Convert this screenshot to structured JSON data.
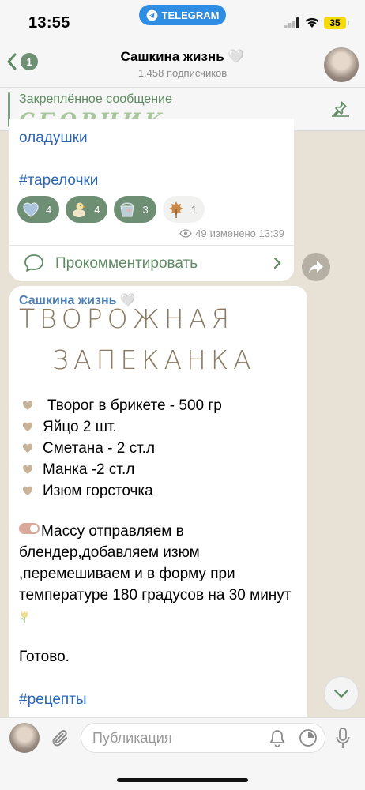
{
  "status_bar": {
    "time": "13:55",
    "app_pill": "TELEGRAM",
    "battery": "35"
  },
  "header": {
    "back_count": "1",
    "title": "Сашкина жизнь 🤍",
    "subtitle": "1.458 подписчиков"
  },
  "pinned": {
    "label": "Закреплённое сообщение",
    "text": "СБОРНИК"
  },
  "post1": {
    "partial_text": "оладушки",
    "hashtag": "#тарелочки",
    "reactions": [
      {
        "icon": "blue-heart-icon",
        "count": "4"
      },
      {
        "icon": "duck-icon",
        "count": "4"
      },
      {
        "icon": "bucket-icon",
        "count": "3"
      },
      {
        "icon": "autumn-leaf-icon",
        "count": "1"
      }
    ],
    "views": "49",
    "edited": "изменено 13:39",
    "comment_label": "Прокомментировать"
  },
  "post2": {
    "author": "Сашкина жизнь 🤍",
    "heading_line1": "ТВОРОЖНАЯ",
    "heading_line2": "ЗАПЕКАНКА",
    "ingredients": [
      "Творог в брикете - 500 гр",
      "Яйцо 2 шт.",
      "Сметана - 2 ст.л",
      "Манка -2 ст.л",
      "Изюм горсточка"
    ],
    "step_text": "Массу отправляем в блендер,добавляем изюм ,перемешиваем и в форму при температуре 180 градусов на 30 минут",
    "done": "Готово.",
    "hashtag": "#рецепты"
  },
  "input": {
    "placeholder": "Публикация"
  },
  "colors": {
    "accent": "#6f8f74",
    "link": "#2c64b3",
    "background": "#e7e1d6"
  }
}
